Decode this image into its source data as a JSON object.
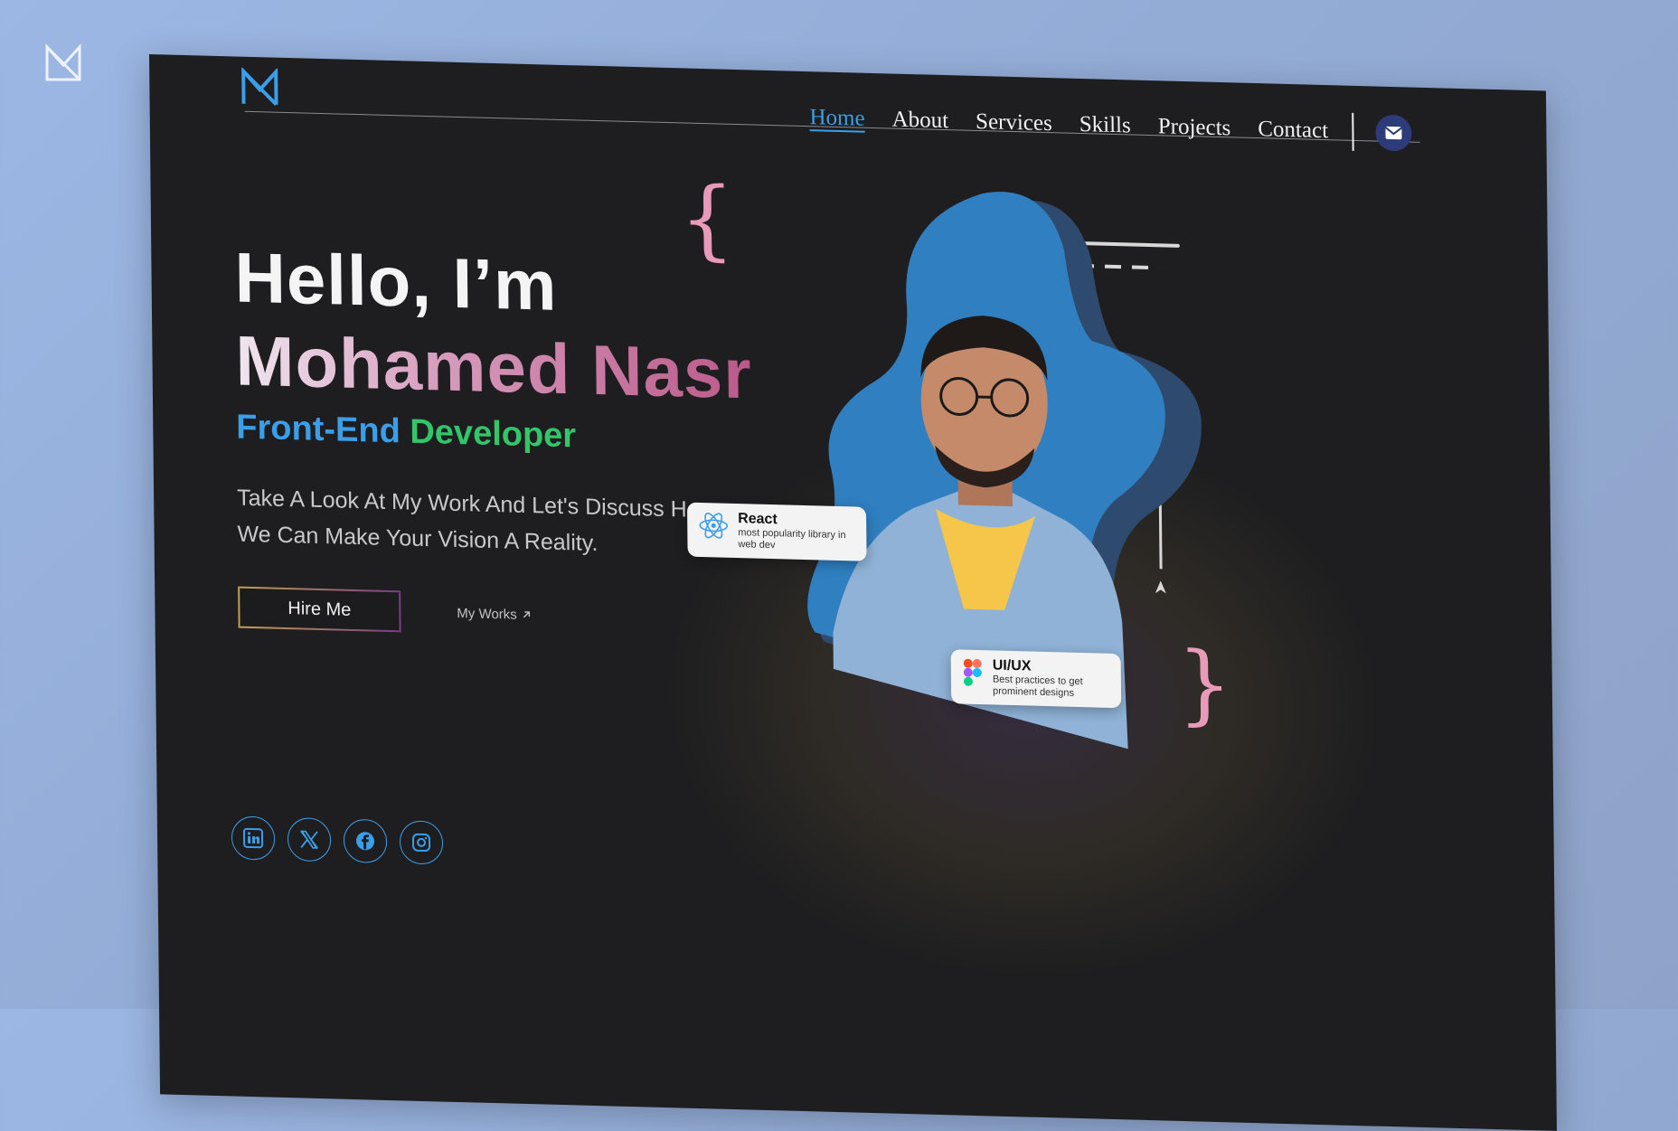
{
  "nav": {
    "items": [
      "Home",
      "About",
      "Services",
      "Skills",
      "Projects",
      "Contact"
    ],
    "active": "Home"
  },
  "hero": {
    "greeting": "Hello, I’m",
    "name": "Mohamed Nasr",
    "role_part1": "Front-End",
    "role_part2": "Developer",
    "tagline": "Take A Look At My Work And Let's Discuss How We Can Make Your Vision A Reality.",
    "hire_label": "Hire Me",
    "works_label": "My Works"
  },
  "cards": {
    "react_title": "React",
    "react_sub": "most popularity library in web dev",
    "uiux_title": "UI/UX",
    "uiux_sub": "Best practices to get prominent designs"
  },
  "socials": [
    "linkedin-icon",
    "x-icon",
    "facebook-icon",
    "instagram-icon"
  ],
  "colors": {
    "accent_blue": "#3b9ee8",
    "accent_green": "#33c56a",
    "accent_pink": "#b44a7e",
    "background": "#1e1e20"
  }
}
